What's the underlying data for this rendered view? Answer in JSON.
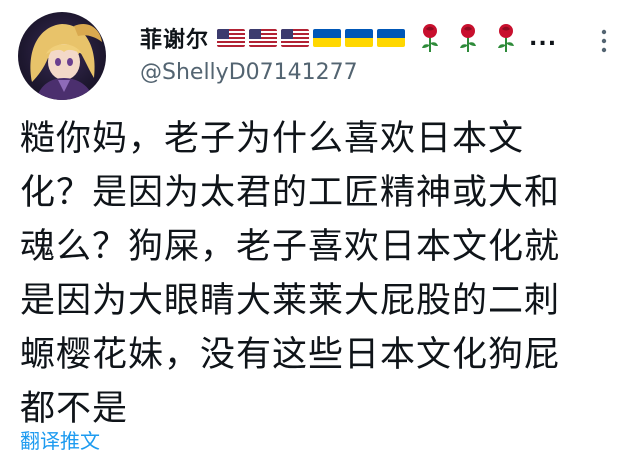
{
  "tweet": {
    "author": {
      "display_name": "菲谢尔",
      "handle": "@ShellyD07141277",
      "flags": [
        "us-flag",
        "us-flag",
        "us-flag",
        "ukraine-flag",
        "ukraine-flag",
        "ukraine-flag"
      ],
      "roses": [
        "rose-icon",
        "rose-icon",
        "rose-icon"
      ],
      "more_dots": "..."
    },
    "text_lines": [
      "糙你妈，老子为什么喜欢日本文",
      "化？是因为太君的工匠精神或大和",
      "魂么？狗屎，老子喜欢日本文化就",
      "是因为大眼睛大莱莱大屁股的二刺",
      "螈樱花妹，没有这些日本文化狗屁",
      "都不是"
    ],
    "translate_label": "翻译推文"
  },
  "colors": {
    "text": "#0f1419",
    "handle": "#536471",
    "link": "#1d9bf0",
    "ukraine_blue": "#0057b7",
    "ukraine_yellow": "#ffd700",
    "rose_red": "#c8102e"
  }
}
